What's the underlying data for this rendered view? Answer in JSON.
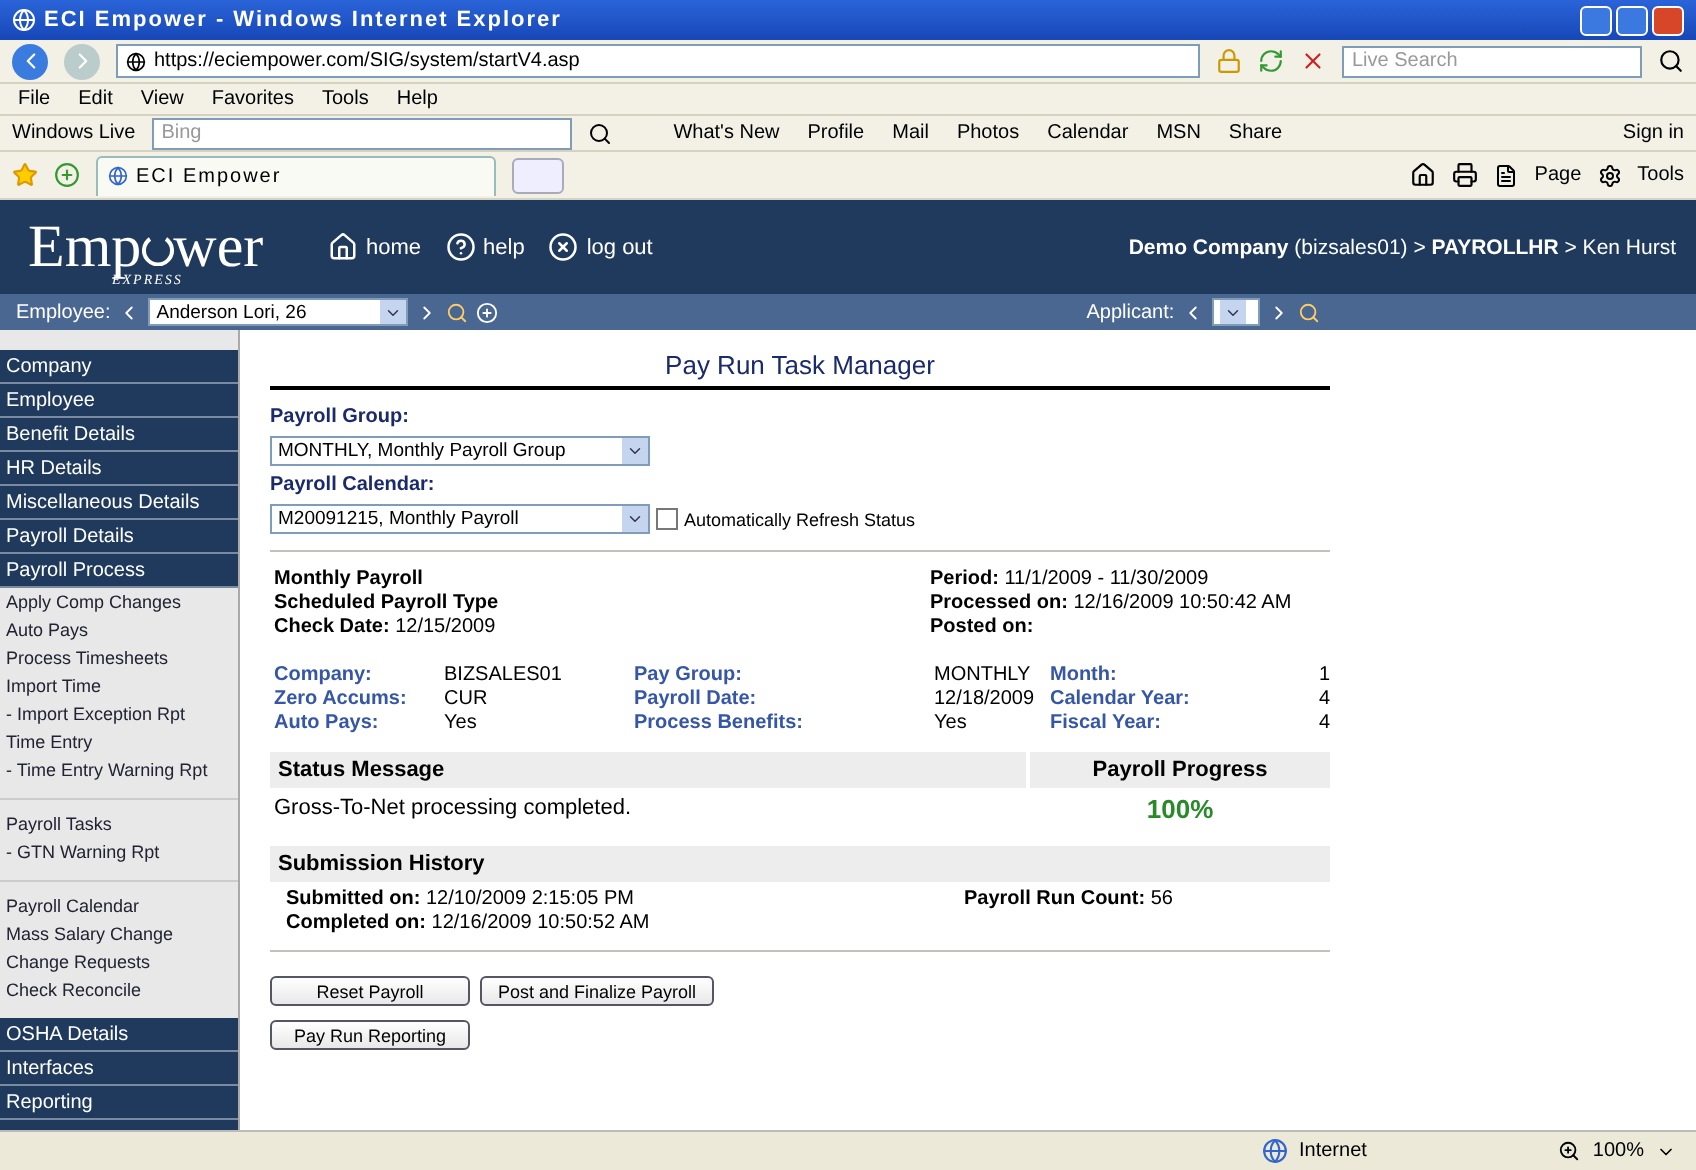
{
  "window": {
    "title": "ECI Empower - Windows Internet Explorer"
  },
  "address_bar": {
    "url": "https://eciempower.com/SIG/system/startV4.asp",
    "search_placeholder": "Live Search"
  },
  "menu": [
    "File",
    "Edit",
    "View",
    "Favorites",
    "Tools",
    "Help"
  ],
  "links_bar": {
    "brand": "Windows Live",
    "search_placeholder": "Bing",
    "links": [
      "What's New",
      "Profile",
      "Mail",
      "Photos",
      "Calendar",
      "MSN",
      "Share"
    ],
    "sign_in": "Sign in"
  },
  "tab_bar": {
    "tab": "ECI Empower",
    "commands": [
      "Page",
      "Tools"
    ]
  },
  "header": {
    "logo": "Emp",
    "logo_rest": "wer",
    "logo_sub": "EXPRESS",
    "nav": [
      {
        "kind": "home",
        "label": "home"
      },
      {
        "kind": "help",
        "label": "help"
      },
      {
        "kind": "logout",
        "label": "log out"
      }
    ],
    "context": "**Demo Company** (bizsales01) > **PAYROLLHR** > Ken Hurst"
  },
  "employee_bar": {
    "label": "Employee:",
    "value": "Anderson Lori, 26",
    "applicant_label": "Applicant:"
  },
  "sidebar": [
    {
      "label": "Company"
    },
    {
      "label": "Employee"
    },
    {
      "label": "Benefit Details"
    },
    {
      "label": "HR Details"
    },
    {
      "label": "Miscellaneous Details"
    },
    {
      "label": "Payroll Details"
    },
    {
      "label": "Payroll Process",
      "groups": [
        [
          "Apply Comp Changes",
          "Auto Pays",
          "Process Timesheets",
          "Import Time",
          "- Import Exception Rpt",
          "Time Entry",
          "- Time Entry Warning Rpt"
        ],
        [
          "Payroll Tasks",
          "- GTN Warning Rpt"
        ],
        [
          "Payroll Calendar",
          "Mass Salary Change",
          "Change Requests",
          "Check Reconcile"
        ]
      ]
    },
    {
      "label": "OSHA Details"
    },
    {
      "label": "Interfaces"
    },
    {
      "label": "Reporting"
    }
  ],
  "main": {
    "title": "Pay Run Task Manager",
    "payroll_group": {
      "label": "Payroll Group:",
      "value": "MONTHLY, Monthly Payroll Group"
    },
    "payroll_calendar": {
      "label": "Payroll Calendar:",
      "value": "M20091215, Monthly Payroll"
    },
    "auto_refresh": {
      "label": "Automatically Refresh Status",
      "checked": false
    },
    "summary_left": [
      "Monthly Payroll",
      "Scheduled Payroll Type",
      "**Check Date:** 12/15/2009"
    ],
    "summary_right": [
      "**Period:** 11/1/2009 - 11/30/2009",
      "**Processed on:** 12/16/2009 10:50:42 AM",
      "**Posted on:**"
    ],
    "details": [
      {
        "label": "Company:",
        "value": "BIZSALES01"
      },
      {
        "label": "Pay Group:",
        "value": "MONTHLY"
      },
      {
        "label": "Month:",
        "value": "1"
      },
      {
        "label": "Zero Accums:",
        "value": "CUR"
      },
      {
        "label": "Payroll Date:",
        "value": "12/18/2009"
      },
      {
        "label": "Calendar Year:",
        "value": "4"
      },
      {
        "label": "Auto Pays:",
        "value": "Yes"
      },
      {
        "label": "Process Benefits:",
        "value": "Yes"
      },
      {
        "label": "Fiscal Year:",
        "value": "4"
      }
    ],
    "status": {
      "heading": "Status Message",
      "message": "Gross-To-Net processing completed.",
      "progress_heading": "Payroll Progress",
      "progress": "100%"
    },
    "history": {
      "heading": "Submission History",
      "lines": [
        "**Submitted on:** 12/10/2009 2:15:05 PM",
        "**Completed on:** 12/16/2009 10:50:52 AM"
      ],
      "run_count": "**Payroll Run Count:** 56"
    },
    "buttons": [
      [
        "Reset Payroll",
        "Post and Finalize Payroll"
      ],
      [
        "Pay Run Reporting"
      ]
    ]
  },
  "status_bar": {
    "zone": "Internet",
    "zoom": "100%"
  }
}
